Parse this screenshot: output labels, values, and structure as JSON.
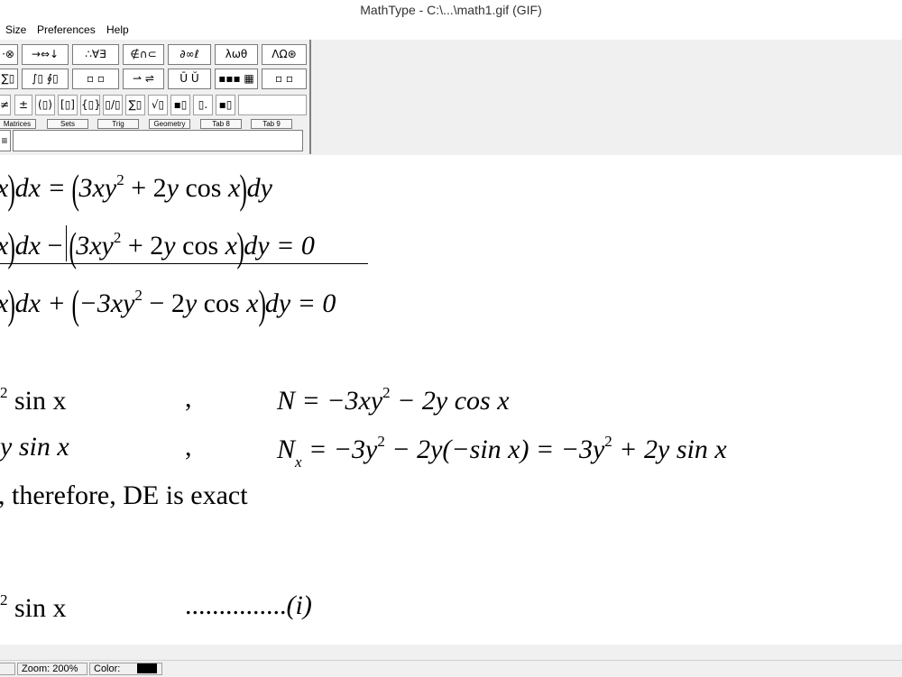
{
  "window": {
    "title": "MathType - C:\\...\\math1.gif (GIF)"
  },
  "menu": {
    "items": [
      "Size",
      "Preferences",
      "Help"
    ]
  },
  "palette": {
    "row1": [
      "·⊗",
      "→⇔↓",
      "∴∀∃",
      "∉∩⊂",
      "∂∞ℓ",
      "λωθ",
      "ΛΩ⊛"
    ],
    "row2": [
      "∑▯",
      "∫▯ ∮▯",
      "▫ ▫",
      "⇀ ⇌",
      "Ū Ŭ",
      "▪▪▪ ▦",
      "▫ ▫"
    ],
    "row3": [
      "≠",
      "±",
      "(▯)",
      "[▯]",
      "{▯}",
      "▯/▯",
      "∑▯",
      "√▯",
      "▪▯",
      "▯.",
      "▪▯"
    ],
    "tabs": [
      "Matrices",
      "Sets",
      "Trig",
      "Geometry",
      "Tab 8",
      "Tab 9"
    ],
    "row5_icon": "≡"
  },
  "doc": {
    "line1": {
      "a": "x",
      "b": "dx = ",
      "c": "3xy",
      "c_sup": "2",
      "d": " + 2",
      "e": "y",
      "f": " cos ",
      "g": "x",
      "h": "dy"
    },
    "line2": {
      "a": "x",
      "b": "dx",
      "c": "3xy",
      "c_sup": "2",
      "d": " + 2",
      "e": "y",
      "f": " cos ",
      "g": "x",
      "h": "dy = 0"
    },
    "line3": {
      "a": "x",
      "b": "dx + ",
      "c": "−3xy",
      "c_sup": "2",
      "d": " − 2",
      "e": "y",
      "f": " cos ",
      "g": "x",
      "h": "dy = 0"
    },
    "line4": {
      "left_sup": "2",
      "left": " sin x",
      "comma": ",",
      "right": "N = −3xy",
      "right_sup": "2",
      "right_tail": " − 2y cos x"
    },
    "line5": {
      "left": "y sin x",
      "comma": ",",
      "right_head": "N",
      "right_sub": "x",
      "right_mid": " = −3y",
      "right_sup1": "2",
      "right_mid2": " − 2y(−sin x) = −3y",
      "right_sup2": "2",
      "right_tail": " + 2y sin x"
    },
    "line6": {
      "text": ", therefore, DE is exact"
    },
    "line7": {
      "left_sup": "2",
      "left": " sin x",
      "dots": "...............",
      "label": "(i)"
    }
  },
  "status": {
    "zoom": "Zoom: 200%",
    "color_label": "Color:",
    "color": "#000000"
  }
}
